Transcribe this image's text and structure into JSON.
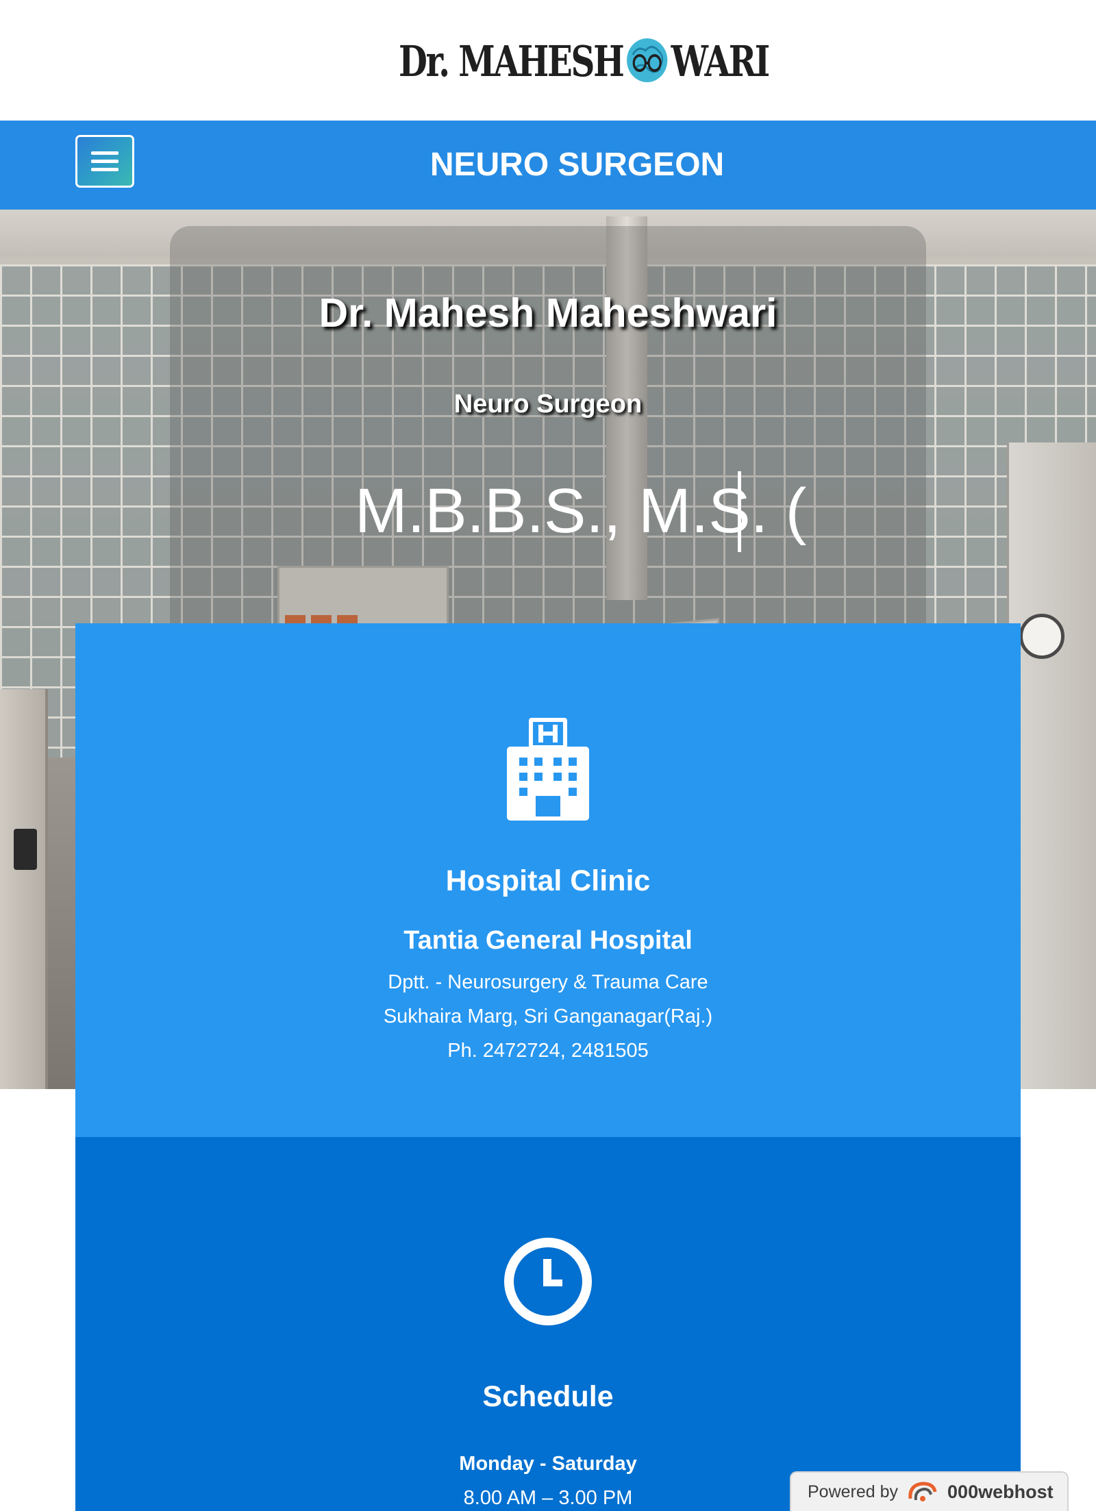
{
  "logo": {
    "text_before": "Dr. MAHESH",
    "text_after": "WARI",
    "icon": "brain-glasses-icon"
  },
  "navbar": {
    "menu_icon": "hamburger-menu-icon",
    "title": "NEURO SURGEON"
  },
  "hero": {
    "name": "Dr. Mahesh Maheshwari",
    "role": "Neuro Surgeon",
    "degree_typed": "M.B.B.S., M.S. ("
  },
  "hospital_card": {
    "icon": "hospital-icon",
    "heading": "Hospital Clinic",
    "hospital_name": "Tantia General Hospital",
    "lines": [
      "Dptt. - Neurosurgery & Trauma Care",
      "Sukhaira Marg, Sri Ganganagar(Raj.)",
      "Ph. 2472724, 2481505"
    ]
  },
  "schedule_card": {
    "icon": "clock-icon",
    "heading": "Schedule",
    "days": "Monday - Saturday",
    "hours": "8.00 AM – 3.00 PM"
  },
  "powered": {
    "label": "Powered by",
    "brand": "000webhost",
    "icon": "000webhost-logo-icon"
  },
  "colors": {
    "nav_blue": "#258be4",
    "card_blue_light": "#2897f0",
    "card_blue_dark": "#0270d0",
    "logo_brain_teal": "#3fb6d6",
    "logo_text": "#1f1f1f"
  }
}
